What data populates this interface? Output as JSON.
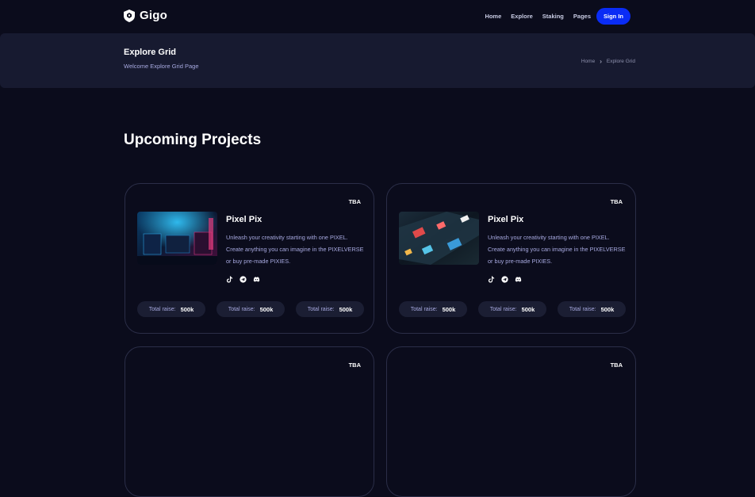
{
  "nav": {
    "logo_text": "Gigo",
    "links": [
      "Home",
      "Explore",
      "Staking",
      "Pages"
    ],
    "signin_label": "Sign In"
  },
  "banner": {
    "title": "Explore Grid",
    "subtitle": "Welcome Explore Grid Page",
    "breadcrumb": [
      "Home",
      "Explore Grid"
    ]
  },
  "section": {
    "title": "Upcoming Projects"
  },
  "cards": [
    {
      "tag": "TBA",
      "title": "Pixel Pix",
      "description": "Unleash your creativity starting with one PIXEL. Create anything you can imagine in the PIXELVERSE or buy pre-made PIXIES.",
      "socials": [
        "tiktok-icon",
        "telegram-icon",
        "discord-icon"
      ],
      "stats": [
        {
          "label": "Total raise:",
          "value": "500k"
        },
        {
          "label": "Total raise:",
          "value": "500k"
        },
        {
          "label": "Total raise:",
          "value": "500k"
        }
      ]
    },
    {
      "tag": "TBA",
      "title": "Pixel Pix",
      "description": "Unleash your creativity starting with one PIXEL. Create anything you can imagine in the PIXELVERSE or buy pre-made PIXIES.",
      "socials": [
        "tiktok-icon",
        "telegram-icon",
        "discord-icon"
      ],
      "stats": [
        {
          "label": "Total raise:",
          "value": "500k"
        },
        {
          "label": "Total raise:",
          "value": "500k"
        },
        {
          "label": "Total raise:",
          "value": "500k"
        }
      ]
    },
    {
      "tag": "TBA"
    },
    {
      "tag": "TBA"
    }
  ],
  "colors": {
    "background": "#0b0c1c",
    "banner": "#171a30",
    "accent": "#0a2cf5",
    "muted_text": "#a7a9e0",
    "card_border": "#2b2e48"
  }
}
